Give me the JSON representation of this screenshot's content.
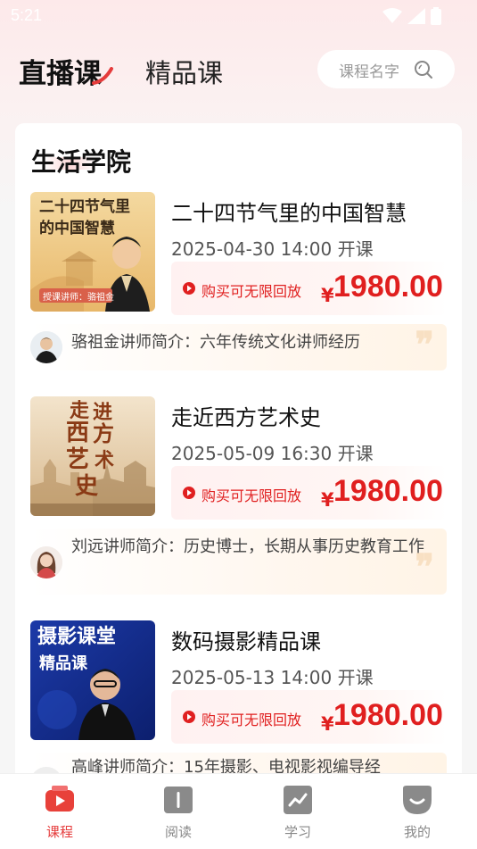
{
  "status_bar": {
    "time": "5:21"
  },
  "header": {
    "tab_live": "直播课",
    "tab_premium": "精品课",
    "search_placeholder": "课程名字"
  },
  "section": {
    "title": "生活学院"
  },
  "courses": [
    {
      "title": "二十四节气里的中国智慧",
      "time": "2025-04-30 14:00 开课",
      "replay": "购买可无限回放",
      "currency": "¥",
      "price": "1980.00",
      "intro": "骆祖金讲师简介：六年传统文化讲师经历",
      "thumb": {
        "line1": "二十四节气里",
        "line2": "的中国智慧",
        "badge": "授课讲师：骆祖金"
      }
    },
    {
      "title": "走近西方艺术史",
      "time": "2025-05-09 16:30 开课",
      "replay": "购买可无限回放",
      "currency": "¥",
      "price": "1980.00",
      "intro": "刘远讲师简介：历史博士，长期从事历史教育工作",
      "thumb": {
        "c1": "走",
        "c2": "进",
        "c3": "西",
        "c4": "方",
        "c5": "艺",
        "c6": "术",
        "c7": "史"
      }
    },
    {
      "title": "数码摄影精品课",
      "time": "2025-05-13 14:00 开课",
      "replay": "购买可无限回放",
      "currency": "¥",
      "price": "1980.00",
      "intro": "高峰讲师简介：15年摄影、电视影视编导经",
      "thumb": {
        "line1": "摄影课堂",
        "line2": "精品课"
      }
    }
  ],
  "bottom_nav": [
    {
      "label": "课程",
      "icon": "course-play-icon",
      "active": true
    },
    {
      "label": "阅读",
      "icon": "book-icon",
      "active": false
    },
    {
      "label": "学习",
      "icon": "study-chart-icon",
      "active": false
    },
    {
      "label": "我的",
      "icon": "profile-smile-icon",
      "active": false
    }
  ],
  "colors": {
    "accent": "#e53b3b",
    "price": "#e01f1f"
  }
}
